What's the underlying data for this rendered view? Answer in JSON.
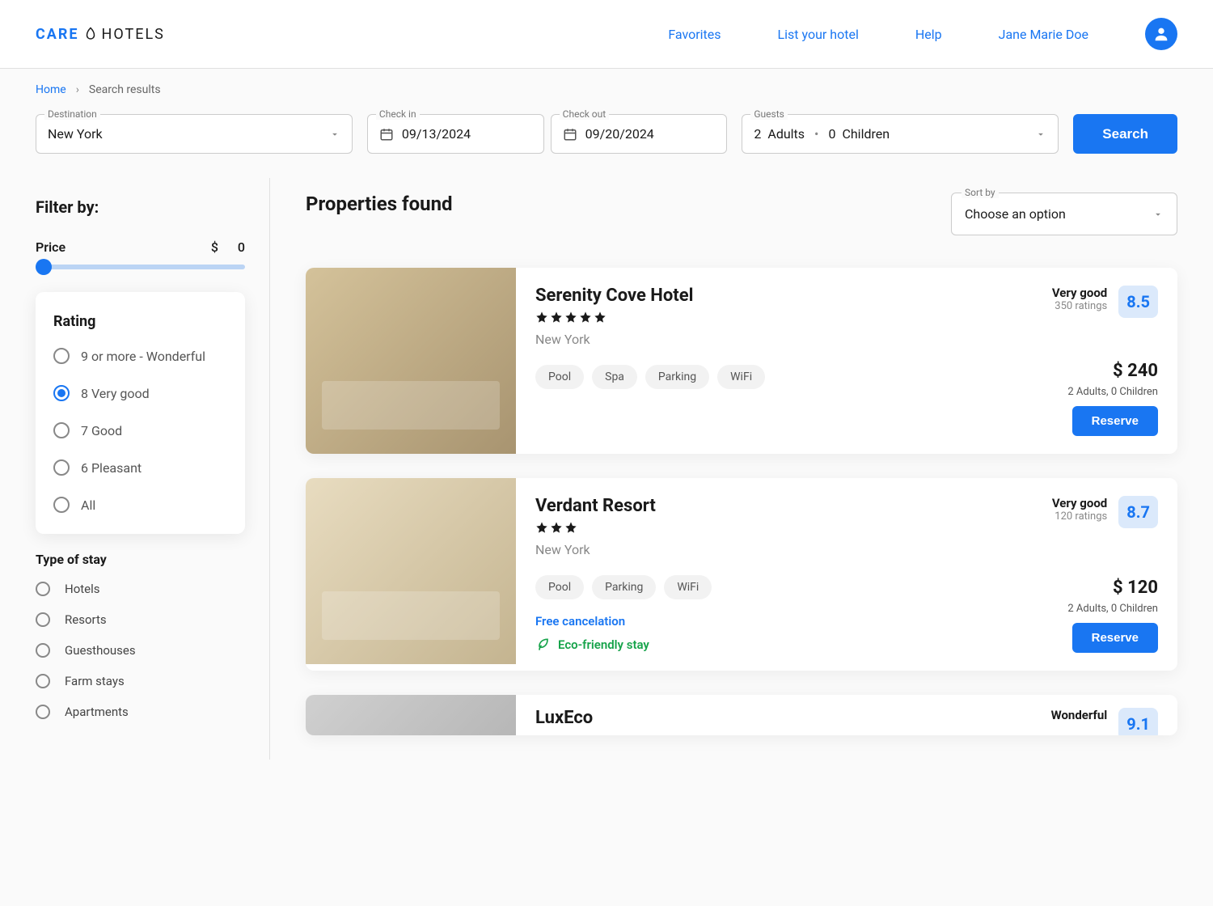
{
  "header": {
    "logo_care": "CARE",
    "logo_hotels": "HOTELS",
    "nav": {
      "favorites": "Favorites",
      "list_hotel": "List your hotel",
      "help": "Help",
      "user_name": "Jane Marie Doe"
    }
  },
  "breadcrumb": {
    "home": "Home",
    "current": "Search results"
  },
  "search": {
    "destination_label": "Destination",
    "destination_value": "New York",
    "checkin_label": "Check in",
    "checkin_value": "09/13/2024",
    "checkout_label": "Check out",
    "checkout_value": "09/20/2024",
    "guests_label": "Guests",
    "guests_adults_num": "2",
    "guests_adults": "Adults",
    "guests_children_num": "0",
    "guests_children": "Children",
    "search_btn": "Search"
  },
  "sidebar": {
    "filter_title": "Filter by:",
    "price_label": "Price",
    "price_currency": "$",
    "price_value": "0",
    "rating_title": "Rating",
    "rating_options": [
      "9 or more -  Wonderful",
      "8 Very good",
      "7 Good",
      "6 Pleasant",
      "All"
    ],
    "rating_selected_index": 1,
    "stay_title": "Type of stay",
    "stay_options": [
      "Hotels",
      "Resorts",
      "Guesthouses",
      "Farm stays",
      "Apartments"
    ]
  },
  "content": {
    "title": "Properties found",
    "sort_label": "Sort by",
    "sort_value": "Choose an option",
    "reserve_label": "Reserve",
    "properties": [
      {
        "name": "Serenity Cove Hotel",
        "stars": 5,
        "location": "New York",
        "tags": [
          "Pool",
          "Spa",
          "Parking",
          "WiFi"
        ],
        "rating_label": "Very good",
        "rating_count": "350 ratings",
        "rating_score": "8.5",
        "price": "$ 240",
        "guests_info": "2 Adults,  0 Children",
        "free_cancel": "",
        "eco": ""
      },
      {
        "name": "Verdant Resort",
        "stars": 3,
        "location": "New York",
        "tags": [
          "Pool",
          "Parking",
          "WiFi"
        ],
        "rating_label": "Very good",
        "rating_count": "120 ratings",
        "rating_score": "8.7",
        "price": "$ 120",
        "guests_info": "2 Adults,  0 Children",
        "free_cancel": "Free cancelation",
        "eco": "Eco-friendly stay"
      },
      {
        "name": "LuxEco",
        "stars": 0,
        "location": "",
        "tags": [],
        "rating_label": "Wonderful",
        "rating_count": "",
        "rating_score": "9.1",
        "price": "",
        "guests_info": "",
        "free_cancel": "",
        "eco": ""
      }
    ]
  }
}
